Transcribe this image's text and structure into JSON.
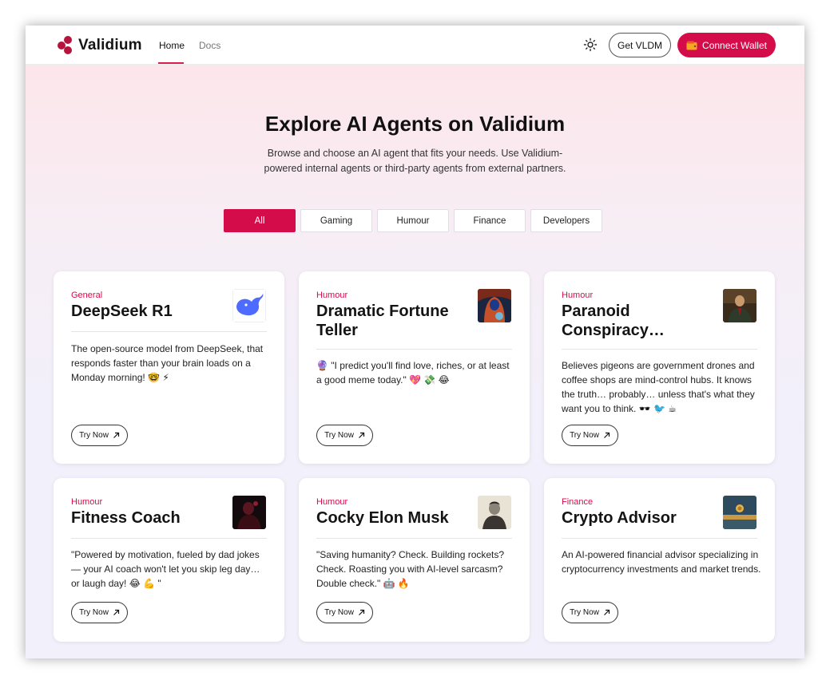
{
  "nav": {
    "brand": "Validium",
    "links": [
      {
        "label": "Home",
        "active": true
      },
      {
        "label": "Docs",
        "active": false
      }
    ],
    "get_token_label": "Get VLDM",
    "connect_label": "Connect Wallet",
    "theme_icon": "sun-icon"
  },
  "hero": {
    "title": "Explore AI Agents on Validium",
    "subtitle": "Browse and choose an AI agent that fits your needs. Use Validium-powered internal agents or third-party agents from external partners."
  },
  "filters": [
    {
      "label": "All",
      "active": true
    },
    {
      "label": "Gaming",
      "active": false
    },
    {
      "label": "Humour",
      "active": false
    },
    {
      "label": "Finance",
      "active": false
    },
    {
      "label": "Developers",
      "active": false
    }
  ],
  "cards": [
    {
      "category": "General",
      "title": "DeepSeek R1",
      "description": "The open-source model from DeepSeek, that responds faster than your brain loads on a Monday morning! 🤓 ⚡",
      "cta": "Try Now",
      "image": "whale-logo"
    },
    {
      "category": "Humour",
      "title": "Dramatic Fortune Teller",
      "description": "🔮 \"I predict you'll find love, riches, or at least a good meme today.\" 💖 💸 😂",
      "cta": "Try Now",
      "image": "fortune-teller-portrait"
    },
    {
      "category": "Humour",
      "title": "Paranoid Conspiracy…",
      "description": "Believes pigeons are government drones and coffee shops are mind-control hubs. It knows the truth… probably… unless that's what they want you to think. 🕶️ 🐦 ☕",
      "cta": "Try Now",
      "image": "man-in-suit-portrait"
    },
    {
      "category": "Humour",
      "title": "Fitness Coach",
      "description": "\"Powered by motivation, fueled by dad jokes — your AI coach won't let you skip leg day… or laugh day! 😂 💪 \"",
      "cta": "Try Now",
      "image": "dark-red-portrait"
    },
    {
      "category": "Humour",
      "title": "Cocky Elon Musk",
      "description": "\"Saving humanity? Check. Building rockets? Check. Roasting you with AI-level sarcasm? Double check.\" 🤖 🔥",
      "cta": "Try Now",
      "image": "sketch-portrait"
    },
    {
      "category": "Finance",
      "title": "Crypto Advisor",
      "description": "An AI-powered financial advisor specializing in cryptocurrency investments and market trends.",
      "cta": "Try Now",
      "image": "crypto-landscape"
    }
  ],
  "colors": {
    "accent": "#d40c4a",
    "brand_mark": "#b5153c"
  }
}
